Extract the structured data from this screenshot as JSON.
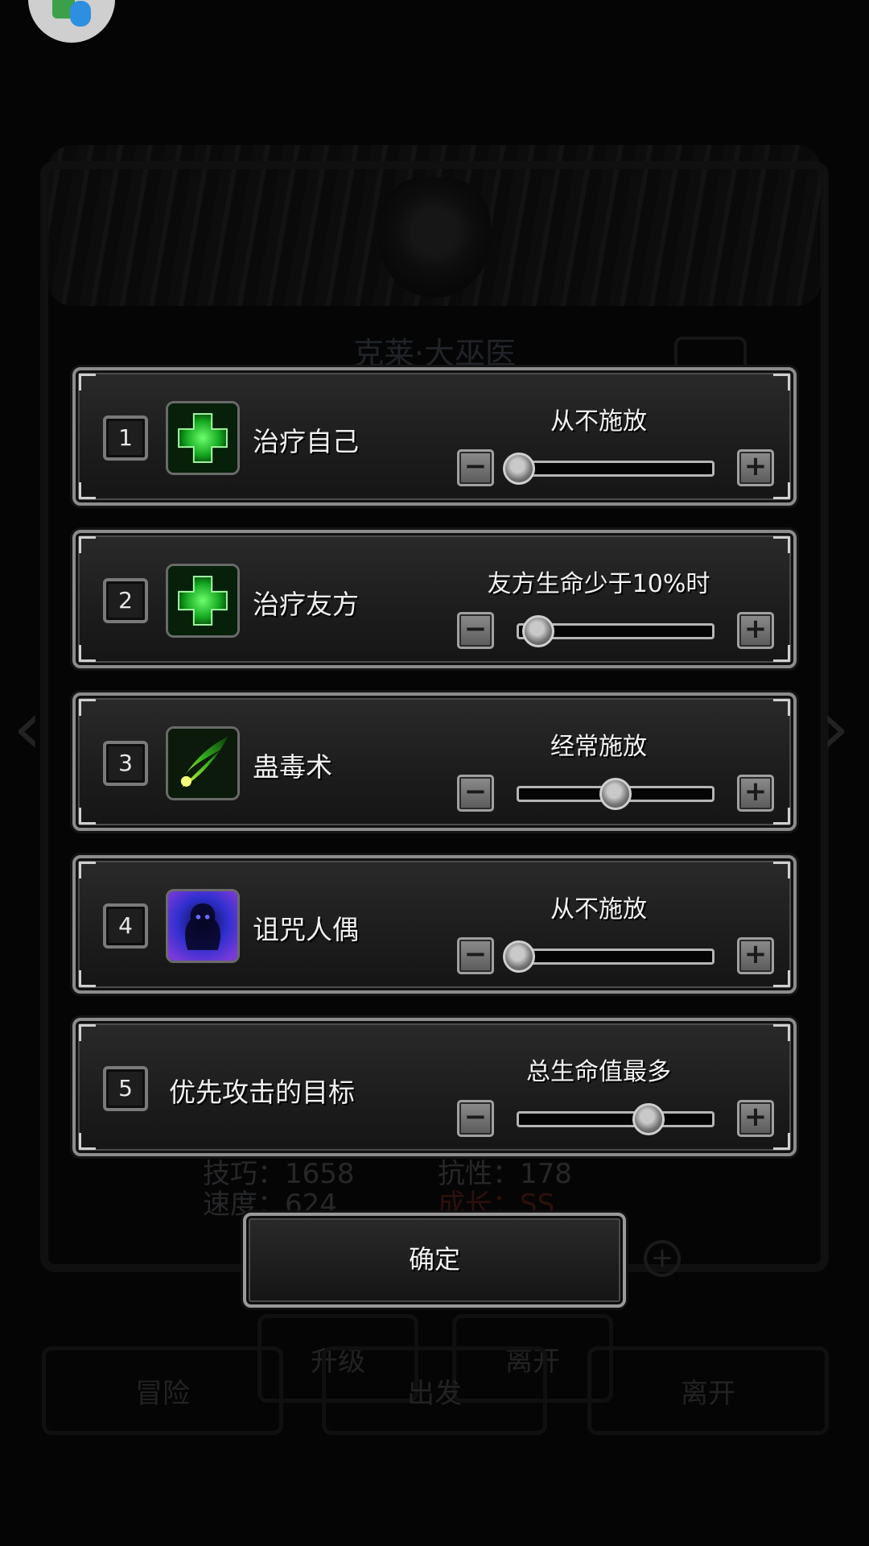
{
  "background": {
    "hero_name": "克莱·大巫医",
    "stats": {
      "skill": "技巧：1658",
      "speed": "速度：624",
      "resist": "抗性：178",
      "growth": "成长：SS"
    },
    "buttons": {
      "upgrade": "升级",
      "leave": "离开",
      "adventure": "冒险",
      "depart": "出发",
      "leave2": "离开"
    }
  },
  "skills": [
    {
      "index": "1",
      "name": "治疗自己",
      "icon": "heal-cross-icon",
      "level_text": "从不施放",
      "level": 0
    },
    {
      "index": "2",
      "name": "治疗友方",
      "icon": "heal-cross-icon",
      "level_text": "友方生命少于10%时",
      "level": 0.1
    },
    {
      "index": "3",
      "name": "蛊毒术",
      "icon": "poison-bolt-icon",
      "level_text": "经常施放",
      "level": 0.5
    },
    {
      "index": "4",
      "name": "诅咒人偶",
      "icon": "curse-doll-icon",
      "level_text": "从不施放",
      "level": 0
    },
    {
      "index": "5",
      "name": "优先攻击的目标",
      "icon": "",
      "level_text": "总生命值最多",
      "level": 0.67
    }
  ],
  "controls": {
    "minus": "−",
    "plus": "+"
  },
  "confirm_label": "确定",
  "colors": {
    "heal_green": "#39e24a",
    "poison_green": "#7fe02a",
    "curse_blue": "#3a3adf",
    "growth_red": "#c0392b"
  }
}
